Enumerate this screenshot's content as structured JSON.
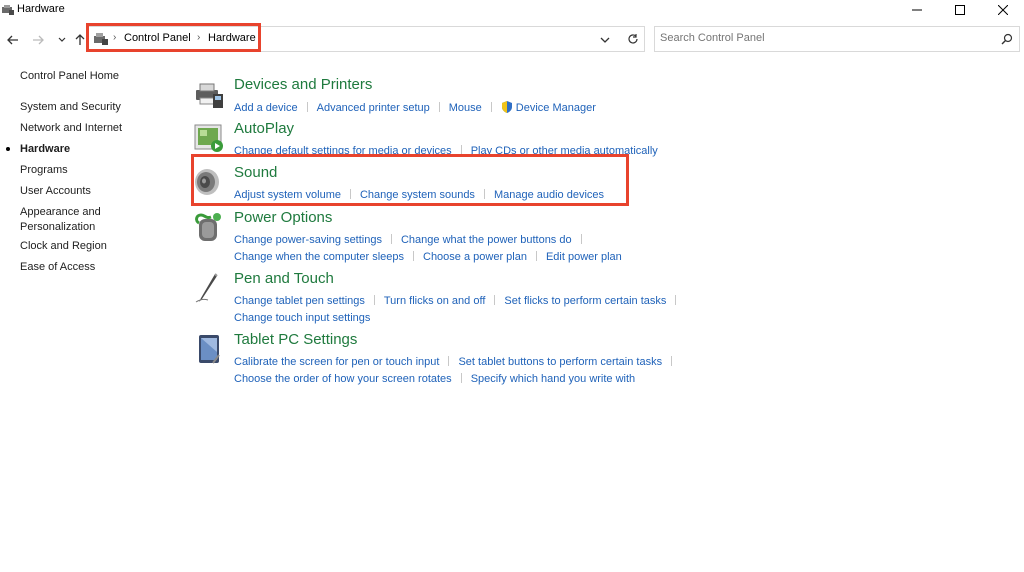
{
  "window": {
    "title": "Hardware"
  },
  "breadcrumb": {
    "items": [
      "Control Panel",
      "Hardware"
    ]
  },
  "search": {
    "placeholder": "Search Control Panel"
  },
  "sidebar": {
    "home": "Control Panel Home",
    "items": [
      {
        "label": "System and Security",
        "active": false
      },
      {
        "label": "Network and Internet",
        "active": false
      },
      {
        "label": "Hardware",
        "active": true
      },
      {
        "label": "Programs",
        "active": false
      },
      {
        "label": "User Accounts",
        "active": false
      },
      {
        "label": "Appearance and Personalization",
        "active": false
      },
      {
        "label": "Clock and Region",
        "active": false
      },
      {
        "label": "Ease of Access",
        "active": false
      }
    ]
  },
  "categories": [
    {
      "title": "Devices and Printers",
      "icon": "printer-icon",
      "links": [
        [
          "Add a device",
          "Advanced printer setup",
          "Mouse",
          "Device Manager"
        ]
      ]
    },
    {
      "title": "AutoPlay",
      "icon": "autoplay-icon",
      "links": [
        [
          "Change default settings for media or devices",
          "Play CDs or other media automatically"
        ]
      ]
    },
    {
      "title": "Sound",
      "icon": "speaker-icon",
      "links": [
        [
          "Adjust system volume",
          "Change system sounds",
          "Manage audio devices"
        ]
      ]
    },
    {
      "title": "Power Options",
      "icon": "power-options-icon",
      "links": [
        [
          "Change power-saving settings",
          "Change what the power buttons do"
        ],
        [
          "Change when the computer sleeps",
          "Choose a power plan",
          "Edit power plan"
        ]
      ]
    },
    {
      "title": "Pen and Touch",
      "icon": "pen-icon",
      "links": [
        [
          "Change tablet pen settings",
          "Turn flicks on and off",
          "Set flicks to perform certain tasks"
        ],
        [
          "Change touch input settings"
        ]
      ]
    },
    {
      "title": "Tablet PC Settings",
      "icon": "tablet-icon",
      "links": [
        [
          "Calibrate the screen for pen or touch input",
          "Set tablet buttons to perform certain tasks"
        ],
        [
          "Choose the order of how your screen rotates",
          "Specify which hand you write with"
        ]
      ]
    }
  ],
  "colors": {
    "accent_link": "#1f62b9",
    "category_title": "#1f7a3e",
    "highlight": "#e8432d"
  }
}
